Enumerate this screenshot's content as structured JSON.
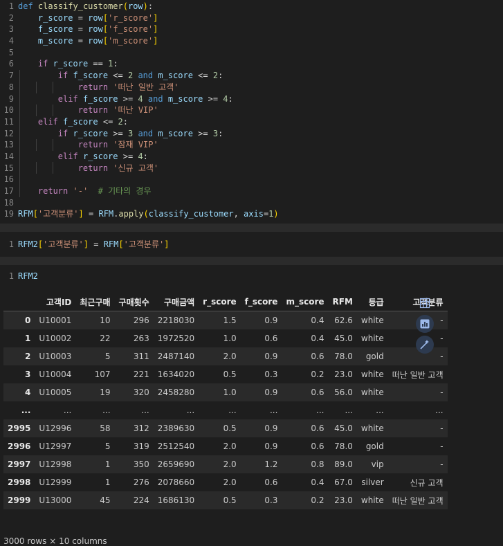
{
  "code_cell": {
    "line_numbers": [
      "1",
      "2",
      "3",
      "4",
      "5",
      "6",
      "7",
      "8",
      "9",
      "10",
      "11",
      "12",
      "13",
      "14",
      "15",
      "16",
      "17",
      "18",
      "19"
    ],
    "tokens": {
      "def": "def",
      "fname": "classify_customer",
      "param": "row",
      "r_score": "r_score",
      "f_score": "f_score",
      "m_score": "m_score",
      "row": "row",
      "if": "if",
      "elif": "elif",
      "and": "and",
      "return": "return",
      "k_r": "'r_score'",
      "k_f": "'f_score'",
      "k_m": "'m_score'",
      "n1": "1",
      "n2": "2",
      "n3": "3",
      "n4": "4",
      "s1": "'떠난 일반 고객'",
      "s2": "'떠난 VIP'",
      "s3": "'잠재 VIP'",
      "s4": "'신규 고객'",
      "s5": "'-'",
      "comment": "# 기타의 경우",
      "rfm": "RFM",
      "key": "'고객분류'",
      "apply": "apply",
      "axis": "axis"
    }
  },
  "cell2": {
    "line": "1",
    "rfm2": "RFM2",
    "rfm": "RFM",
    "key": "'고객분류'"
  },
  "cell3": {
    "line": "1",
    "code": "RFM2"
  },
  "table": {
    "columns": [
      "고객ID",
      "최근구매",
      "구매횟수",
      "구매금액",
      "r_score",
      "f_score",
      "m_score",
      "RFM",
      "등급",
      "고객분류"
    ],
    "rows": [
      {
        "idx": "0",
        "cells": [
          "U10001",
          "10",
          "296",
          "2218030",
          "1.5",
          "0.9",
          "0.4",
          "62.6",
          "white",
          "-"
        ]
      },
      {
        "idx": "1",
        "cells": [
          "U10002",
          "22",
          "263",
          "1972520",
          "1.0",
          "0.6",
          "0.4",
          "45.0",
          "white",
          "-"
        ]
      },
      {
        "idx": "2",
        "cells": [
          "U10003",
          "5",
          "311",
          "2487140",
          "2.0",
          "0.9",
          "0.6",
          "78.0",
          "gold",
          "-"
        ]
      },
      {
        "idx": "3",
        "cells": [
          "U10004",
          "107",
          "221",
          "1634020",
          "0.5",
          "0.3",
          "0.2",
          "23.0",
          "white",
          "떠난 일반 고객"
        ]
      },
      {
        "idx": "4",
        "cells": [
          "U10005",
          "19",
          "320",
          "2458280",
          "1.0",
          "0.9",
          "0.6",
          "56.0",
          "white",
          "-"
        ]
      },
      {
        "idx": "...",
        "cells": [
          "...",
          "...",
          "...",
          "...",
          "...",
          "...",
          "...",
          "...",
          "...",
          "..."
        ]
      },
      {
        "idx": "2995",
        "cells": [
          "U12996",
          "58",
          "312",
          "2389630",
          "0.5",
          "0.9",
          "0.6",
          "45.0",
          "white",
          "-"
        ]
      },
      {
        "idx": "2996",
        "cells": [
          "U12997",
          "5",
          "319",
          "2512540",
          "2.0",
          "0.9",
          "0.6",
          "78.0",
          "gold",
          "-"
        ]
      },
      {
        "idx": "2997",
        "cells": [
          "U12998",
          "1",
          "350",
          "2659690",
          "2.0",
          "1.2",
          "0.8",
          "89.0",
          "vip",
          "-"
        ]
      },
      {
        "idx": "2998",
        "cells": [
          "U12999",
          "1",
          "276",
          "2078660",
          "2.0",
          "0.6",
          "0.4",
          "67.0",
          "silver",
          "신규 고객"
        ]
      },
      {
        "idx": "2999",
        "cells": [
          "U13000",
          "45",
          "224",
          "1686130",
          "0.5",
          "0.3",
          "0.2",
          "23.0",
          "white",
          "떠난 일반 고객"
        ]
      }
    ]
  },
  "shape_text": "3000 rows × 10 columns",
  "icons": [
    "table-icon",
    "chart-icon",
    "magic-wand-icon"
  ]
}
